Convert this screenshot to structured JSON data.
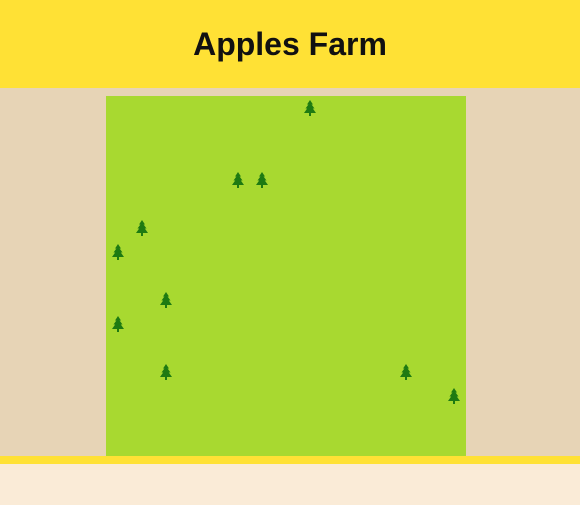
{
  "header": {
    "title": "Apples Farm"
  },
  "colors": {
    "header_bg": "#ffe135",
    "margin_bg": "#e7d4b6",
    "field_bg": "#a8d930",
    "tree": "#1e7a12",
    "footer_bg": "#faebd7"
  },
  "field": {
    "grid_columns": 15,
    "grid_rows": 15,
    "trees": [
      {
        "col": 8,
        "row": 0
      },
      {
        "col": 5,
        "row": 3
      },
      {
        "col": 6,
        "row": 3
      },
      {
        "col": 1,
        "row": 5
      },
      {
        "col": 0,
        "row": 6
      },
      {
        "col": 2,
        "row": 8
      },
      {
        "col": 0,
        "row": 9
      },
      {
        "col": 2,
        "row": 11
      },
      {
        "col": 12,
        "row": 11
      },
      {
        "col": 14,
        "row": 12
      }
    ]
  }
}
